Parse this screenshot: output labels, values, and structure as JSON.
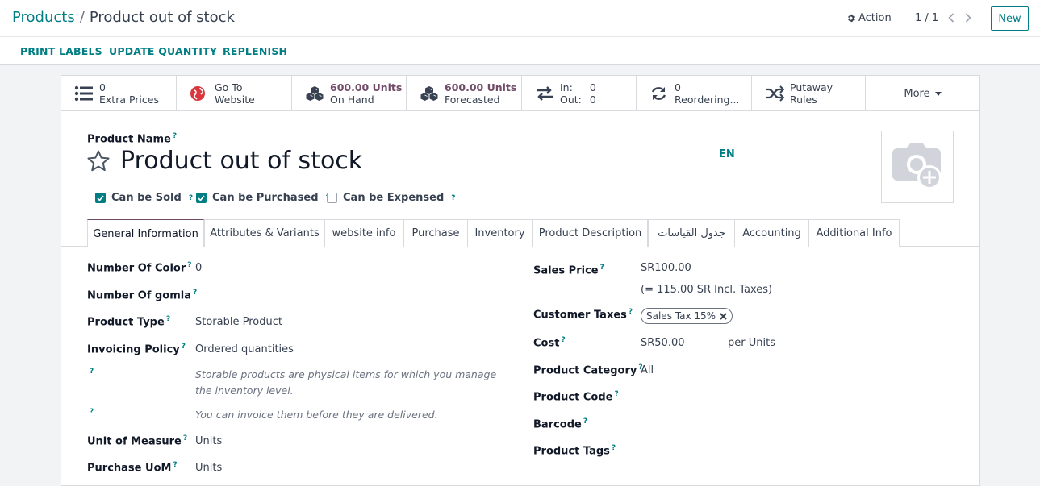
{
  "breadcrumb": {
    "root": "Products",
    "separator": "/",
    "current": "Product out of stock"
  },
  "toolbar": {
    "action_label": "Action",
    "pager": "1 / 1",
    "new_label": "New"
  },
  "statusbar": {
    "buttons": [
      "PRINT LABELS",
      "UPDATE QUANTITY",
      "REPLENISH"
    ]
  },
  "stats": {
    "extra_prices": {
      "value": "0",
      "label": "Extra Prices"
    },
    "website": {
      "line1": "Go To",
      "line2": "Website"
    },
    "on_hand": {
      "value": "600.00 Units",
      "label": "On Hand"
    },
    "forecasted": {
      "value": "600.00 Units",
      "label": "Forecasted"
    },
    "in_out": {
      "in_label": "In:",
      "in_value": "0",
      "out_label": "Out:",
      "out_value": "0"
    },
    "reordering": {
      "value": "0",
      "label": "Reordering..."
    },
    "putaway": {
      "line1": "Putaway",
      "line2": "Rules"
    },
    "more_label": "More"
  },
  "product": {
    "name_label": "Product Name",
    "name": "Product out of stock",
    "lang": "EN",
    "can_be_sold": "Can be Sold",
    "can_be_purchased": "Can be Purchased",
    "can_be_expensed": "Can be Expensed"
  },
  "tabs": [
    "General Information",
    "Attributes & Variants",
    "website info",
    "Purchase",
    "Inventory",
    "Product Description",
    "جدول القياسات",
    "Accounting",
    "Additional Info"
  ],
  "left_fields": {
    "color_label": "Number Of Color",
    "color_value": "0",
    "gomla_label": "Number Of gomla",
    "type_label": "Product Type",
    "type_value": "Storable Product",
    "policy_label": "Invoicing Policy",
    "policy_value": "Ordered quantities",
    "help1": "Storable products are physical items for which you manage the inventory level.",
    "help2": "You can invoice them before they are delivered.",
    "uom_label": "Unit of Measure",
    "uom_value": "Units",
    "puom_label": "Purchase UoM",
    "puom_value": "Units"
  },
  "right_fields": {
    "price_label": "Sales Price",
    "price_value": "SR100.00",
    "price_incl": "(= 115.00 SR Incl. Taxes)",
    "taxes_label": "Customer Taxes",
    "tax_tag": "Sales Tax 15%",
    "cost_label": "Cost",
    "cost_value": "SR50.00",
    "cost_unit": "per Units",
    "category_label": "Product Category",
    "category_value": "All",
    "code_label": "Product Code",
    "barcode_label": "Barcode",
    "tags_label": "Product Tags"
  },
  "colors": {
    "primary": "#017e84",
    "accent": "#714b67"
  }
}
